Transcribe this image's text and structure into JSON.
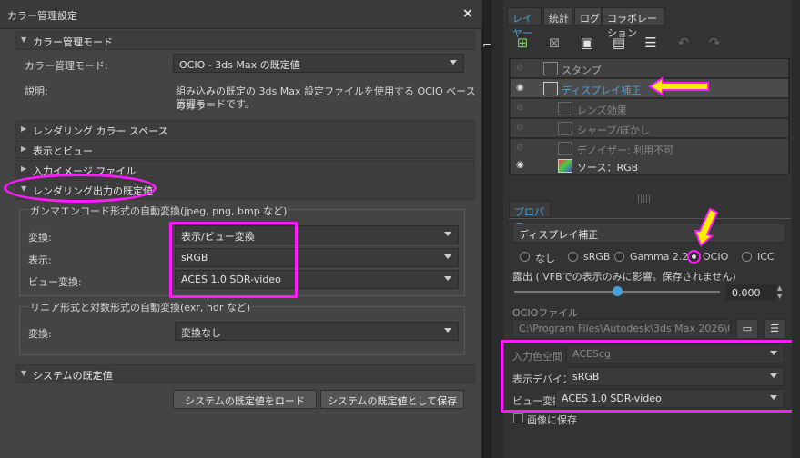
{
  "dialog": {
    "title": "カラー管理設定",
    "close": "×",
    "sections": {
      "mode": "カラー管理モード",
      "rendering_space": "レンダリング カラー スペース",
      "display_view": "表示とビュー",
      "input_image": "入力イメージ ファイル",
      "output_defaults": "レンダリング出力の既定値",
      "system_defaults": "システムの既定値"
    },
    "mode_label": "カラー管理モード:",
    "mode_value": "OCIO - 3ds Max の既定値",
    "desc_label": "説明:",
    "desc_text_1": "組み込みの既定の 3ds Max 設定ファイルを使用する OCIO ベースのカラー",
    "desc_text_2": "管理モードです。",
    "gamma_group_title": "ガンマエンコード形式の自動変換(jpeg, png, bmp など)",
    "transform_label": "変換:",
    "transform_value": "表示/ビュー変換",
    "display_label": "表示:",
    "display_value": "sRGB",
    "view_label": "ビュー変換:",
    "view_value": "ACES 1.0 SDR-video",
    "linear_group_title": "リニア形式と対数形式の自動変換(exr, hdr など)",
    "linear_transform_label": "変換:",
    "linear_transform_value": "変換なし",
    "load_system_btn": "システムの既定値をロード",
    "save_system_btn": "システムの既定値として保存"
  },
  "panel": {
    "tabs": [
      "レイヤー",
      "統計",
      "ログ",
      "コラボレーション"
    ],
    "layers": [
      {
        "name": "スタンプ",
        "visible": false
      },
      {
        "name": "ディスプレイ補正",
        "visible": true
      },
      {
        "name": "レンズ効果",
        "visible": false
      },
      {
        "name": "シャープ/ぼかし",
        "visible": false
      },
      {
        "name": "デノイザー: 利用不可",
        "visible": false
      },
      {
        "name": "ソース：RGB",
        "visible": true
      }
    ],
    "props_tab": "プロパティ",
    "props_name": "ディスプレイ補正",
    "radio": [
      "なし",
      "sRGB",
      "Gamma 2.2",
      "OCIO",
      "ICC"
    ],
    "radio_selected": "OCIO",
    "exposure_label": "露出 ( VFBでの表示のみに影響。保存されません)",
    "exposure_value": "0.000",
    "exposure_fraction": 0.5,
    "ocio_file_label": "OCIOファイル",
    "ocio_file_value": "C:\\Program Files\\Autodesk\\3ds Max 2026\\ColorM",
    "input_space_label": "入力色空間",
    "input_space_value": "ACEScg",
    "display_device_label": "表示デバイス",
    "display_device_value": "sRGB",
    "view_transform_label": "ビュー変換",
    "view_transform_value": "ACES 1.0 SDR-video",
    "save_image_label": "画像に保存"
  },
  "colors": {
    "highlight": "#ff1aff",
    "arrow": "#ffee00",
    "accent": "#4a9fd8"
  }
}
